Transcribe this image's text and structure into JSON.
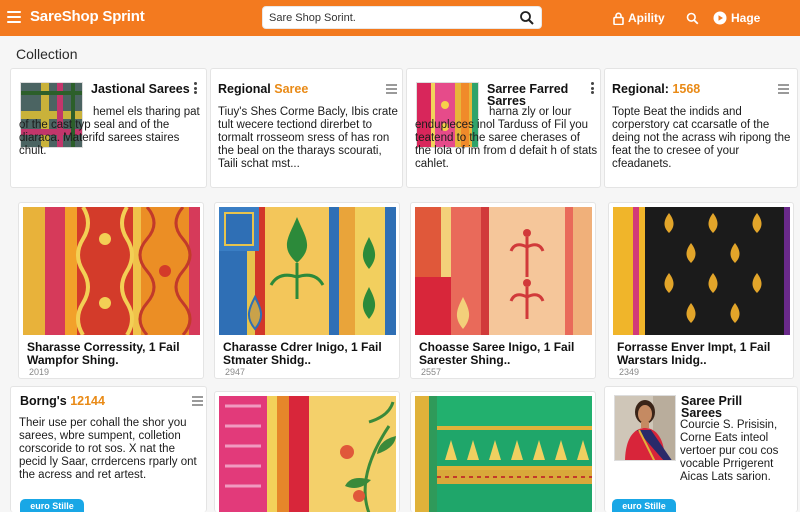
{
  "header": {
    "brand": "SareShop Sprint",
    "search_value": "Sare Shop Sorint.",
    "nav": {
      "apply": "Apility",
      "help": "Hage"
    }
  },
  "page": {
    "title": "Collection"
  },
  "row1": [
    {
      "title": "Jastional Sarees",
      "body": "hemel els tharing pat of the cast typ seal and of the diaraca. Materifd sarees staires chult."
    },
    {
      "title_prefix": "Regional ",
      "title_accent": "Saree",
      "body": "Tiuy's Shes Corme Bacly, Ibis crate tult wecere tectiond direrbet to tormalt rrosseom sress of has ron the beal on the tharays scourati, Taili schat mst..."
    },
    {
      "title": "Sarree Farred Sarres",
      "body": "harna zly or lour endupleces inol Tarduss of Fil you teatend to the saree cherases of the lola of im from d defait h of stats cahlet."
    },
    {
      "title_prefix": "Regional: ",
      "title_accent": "1568",
      "body": "Topte Beat the indids and corperstory cat ccarsatle of the deing not the acrass wih ripong the feat the to cresee of your cfeadanets."
    }
  ],
  "row2": [
    {
      "caption": "Sharasse Corressity, 1 Fail Wampfor Shing.",
      "count": "2019"
    },
    {
      "caption": "Charasse Cdrer Inigo, 1 Fail Stmater Shidg..",
      "count": "2947"
    },
    {
      "caption": "Choasse Saree Inigo, 1 Fail Sarester Shing..",
      "count": "2557"
    },
    {
      "caption": "Forrasse Enver Impt, 1 Fail Warstars Inidg..",
      "count": "2349"
    }
  ],
  "row3": {
    "left": {
      "title_prefix": "Borng's ",
      "title_accent": "12144",
      "body": "Their use per cohall the shor you sarees, wbre sumpent, colletion corscoride to rot sos. X nat the pecid ly Saar, crrdercens rparly ont the acress and ret artest.",
      "button": "euro Stille"
    },
    "right": {
      "title": "Saree Prill Sarees",
      "body": "Courcie S. Prisisin, Corne Eats inteol vertoer pur cou cos vocable Prrigerent Aicas Lats sarion.",
      "button": "euro Stille"
    }
  },
  "colors": {
    "brand_orange": "#f37a1f",
    "accent": "#e98a16",
    "cta_blue": "#19a7e6"
  },
  "icons": [
    "hamburger-icon",
    "search-icon",
    "lock-icon",
    "search-icon",
    "play-circle-icon",
    "more-vert-icon",
    "list-menu-icon"
  ]
}
